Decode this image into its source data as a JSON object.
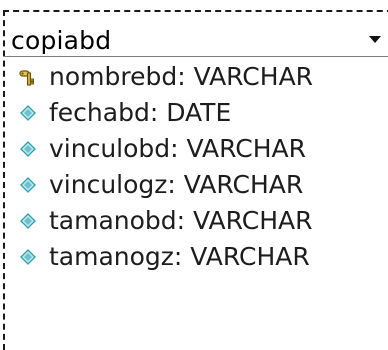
{
  "table": {
    "name": "copiabd",
    "columns": [
      {
        "label": "nombrebd: VARCHAR",
        "icon": "key-icon"
      },
      {
        "label": "fechabd: DATE",
        "icon": "diamond-icon"
      },
      {
        "label": "vinculobd: VARCHAR",
        "icon": "diamond-icon"
      },
      {
        "label": "vinculogz: VARCHAR",
        "icon": "diamond-icon"
      },
      {
        "label": "tamanobd: VARCHAR",
        "icon": "diamond-icon"
      },
      {
        "label": "tamanogz: VARCHAR",
        "icon": "diamond-icon"
      }
    ]
  },
  "colors": {
    "key": "#c9a227",
    "diamond_light": "#bfe9ee",
    "diamond_dark": "#2a9fae"
  }
}
